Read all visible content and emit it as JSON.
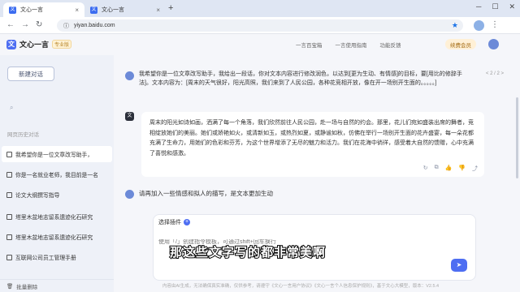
{
  "browser": {
    "tabs": [
      {
        "label": "文心一言",
        "active": true
      },
      {
        "label": "文心一言",
        "active": false
      }
    ],
    "new_tab": "+",
    "url": "yiyan.baidu.com"
  },
  "header": {
    "logo_text": "文心一言",
    "version_badge": "专业版",
    "links": [
      "一言百宝箱",
      "一言使用指南",
      "功能反馈"
    ],
    "vip_label": "续费会员"
  },
  "sidebar": {
    "new_chat": "新建对话",
    "history_title": "网页历史对话",
    "items": [
      {
        "label": "我希望你是一位文章改写助手，",
        "active": true
      },
      {
        "label": "你是一名就业老师，我目前是一名",
        "active": false
      },
      {
        "label": "论文大纲撰写指导",
        "active": false
      },
      {
        "label": "塔里木盆地志留系遗迹化石研究",
        "active": false
      },
      {
        "label": "塔里木盆地志留系遗迹化石研究",
        "active": false
      },
      {
        "label": "互联网公司员工管理手册",
        "active": false
      }
    ],
    "footer": "批量删除"
  },
  "conversation": {
    "user_message": "我希望你是一位文章改写助手，我给出一段话，你对文本内容进行修改润色，以达到[更为生动、有情感]的目标，要[用比的修辞手法]。文本内容为：[周末的天气很好，阳光高照，我们来到了人民公园，各种花竞相开放，像在开一场别开生面的。。。。。]",
    "pager": "< 2 / 2 >",
    "bot_message": "周末的阳光如诗如画，洒满了每一个角落，我们欣然前往人民公园，赴一场与自然的约会。那里，花儿们宛如盛装出席的舞者，竞相绽放她们的美丽。她们或娇艳如火，或清新如玉，或热烈如夏，或静谧如秋，仿佛在举行一场别开生面的花卉盛宴，每一朵花都充满了生命力，用她们的色彩和芬芳，为这个世界增添了无尽的魅力和活力。我们在花海中徜徉，感受着大自然的馈赠，心中充满了喜悦和感激。",
    "user_message_2": "请再加入一些情感和拟人的描写，是文本更加生动"
  },
  "composer": {
    "plugin_label": "选择插件",
    "placeholder": "使用「/」创建指令模板，可通过shift+回车换行"
  },
  "footer_text": "内容由AI生成，无法确保真实准确，仅供参考，请遵守《文心一言用户协议》《文心一言个人信息保护规则》，基于文心大模型，版本：V2.5.4",
  "subtitle": "那这些文字写的都非常美啊",
  "colors": {
    "accent": "#4e6ef2",
    "highlight": "#e84a3c"
  }
}
